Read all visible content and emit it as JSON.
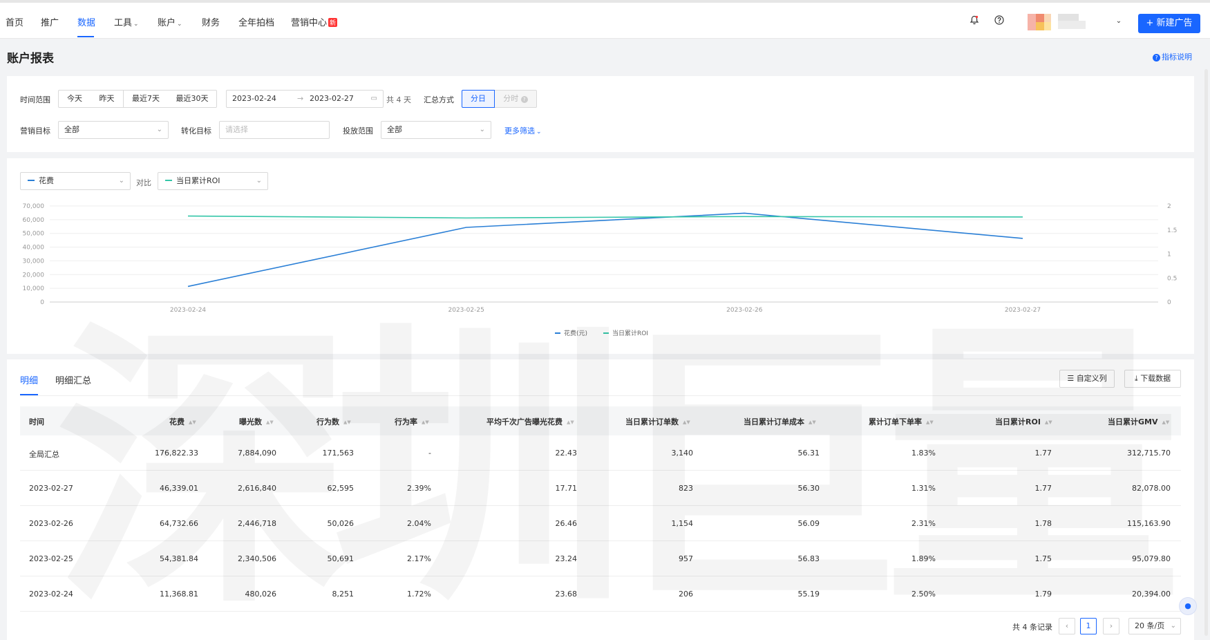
{
  "nav": {
    "items": [
      "首页",
      "推广",
      "数据",
      "工具",
      "账户",
      "财务",
      "全年拍档",
      "营销中心"
    ],
    "active_index": 2,
    "new_badge": "新",
    "new_ad": "+ 新建广告"
  },
  "page": {
    "title": "账户报表",
    "metric_help": "指标说明"
  },
  "filters": {
    "time_range_label": "时间范围",
    "quick_ranges": [
      "今天",
      "昨天",
      "最近7天",
      "最近30天"
    ],
    "start_date": "2023-02-24",
    "end_date": "2023-02-27",
    "day_count": "共 4 天",
    "summary_label": "汇总方式",
    "summary_options": [
      "分日",
      "分时"
    ],
    "marketing_goal_label": "营销目标",
    "marketing_goal_value": "全部",
    "conversion_goal_label": "转化目标",
    "conversion_goal_placeholder": "请选择",
    "delivery_scope_label": "投放范围",
    "delivery_scope_value": "全部",
    "more_filters": "更多筛选"
  },
  "chart_controls": {
    "primary_metric": "花费",
    "compare_label": "对比",
    "secondary_metric": "当日累计ROI"
  },
  "colors": {
    "accent": "#1966ff",
    "series_spend": "#2a7fd6",
    "series_roi": "#34c6a8"
  },
  "chart_data": {
    "type": "line",
    "x": [
      "2023-02-24",
      "2023-02-25",
      "2023-02-26",
      "2023-02-27"
    ],
    "series": [
      {
        "name": "花费(元)",
        "axis": "left",
        "values": [
          11368.81,
          54381.84,
          64732.66,
          46339.01
        ]
      },
      {
        "name": "当日累计ROI",
        "axis": "right",
        "values": [
          1.79,
          1.75,
          1.78,
          1.77
        ]
      }
    ],
    "y_left": {
      "ticks": [
        "70,000",
        "60,000",
        "50,000",
        "40,000",
        "30,000",
        "20,000",
        "10,000",
        "0"
      ],
      "range": [
        0,
        70000
      ]
    },
    "y_right": {
      "ticks": [
        "2",
        "1.5",
        "1",
        "0.5",
        "0"
      ],
      "range": [
        0,
        2
      ]
    },
    "grid": true,
    "legend_position": "bottom-center"
  },
  "tabs": [
    "明细",
    "明细汇总"
  ],
  "toolbar": {
    "custom_columns": "自定义列",
    "download": "下载数据"
  },
  "table": {
    "headers": [
      "时间",
      "花费",
      "曝光数",
      "行为数",
      "行为率",
      "平均千次广告曝光花费",
      "当日累计订单数",
      "当日累计订单成本",
      "累计订单下单率",
      "当日累计ROI",
      "当日累计GMV"
    ],
    "rows": [
      [
        "全局汇总",
        "176,822.33",
        "7,884,090",
        "171,563",
        "-",
        "22.43",
        "3,140",
        "56.31",
        "1.83%",
        "1.77",
        "312,715.70"
      ],
      [
        "2023-02-27",
        "46,339.01",
        "2,616,840",
        "62,595",
        "2.39%",
        "17.71",
        "823",
        "56.30",
        "1.31%",
        "1.77",
        "82,078.00"
      ],
      [
        "2023-02-26",
        "64,732.66",
        "2,446,718",
        "50,026",
        "2.04%",
        "26.46",
        "1,154",
        "56.09",
        "2.31%",
        "1.78",
        "115,163.90"
      ],
      [
        "2023-02-25",
        "54,381.84",
        "2,340,506",
        "50,691",
        "2.17%",
        "23.24",
        "957",
        "56.83",
        "1.89%",
        "1.75",
        "95,079.80"
      ],
      [
        "2023-02-24",
        "11,368.81",
        "480,026",
        "8,251",
        "1.72%",
        "23.68",
        "206",
        "55.19",
        "2.50%",
        "1.79",
        "20,394.00"
      ]
    ]
  },
  "pagination": {
    "total": "共 4 条记录",
    "current_page": "1",
    "page_size": "20 条/页"
  },
  "watermark_text": "深圳巨量"
}
